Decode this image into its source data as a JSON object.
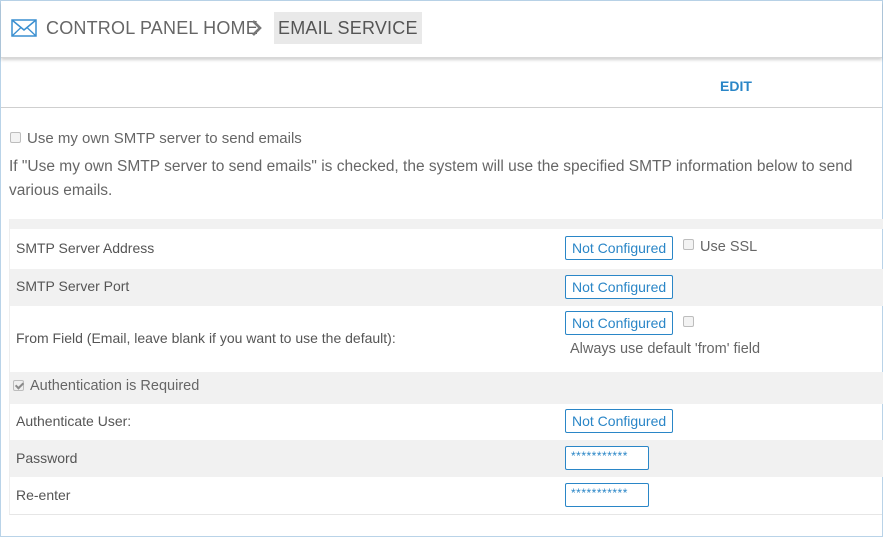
{
  "breadcrumb": {
    "icon": "envelope-icon",
    "home": "CONTROL PANEL HOME",
    "separator_icon": "chevron-right-icon",
    "current": "EMAIL SERVICE"
  },
  "toolbar": {
    "edit": "EDIT"
  },
  "own_smtp": {
    "label": "Use my own SMTP server to send emails",
    "checked": false,
    "description": "If \"Use my own SMTP server to send emails\" is checked, the system will use the specified SMTP information below to send various emails."
  },
  "settings": {
    "server_address": {
      "label": "SMTP Server Address",
      "value": "Not Configured",
      "ssl_label": "Use SSL",
      "ssl_checked": false
    },
    "server_port": {
      "label": "SMTP Server Port",
      "value": "Not Configured"
    },
    "from_field": {
      "label": "From Field (Email, leave blank if you want to use the default):",
      "value": "Not Configured",
      "default_from_label": "Always use default 'from' field",
      "default_from_checked": false
    },
    "auth_required": {
      "label": "Authentication is Required",
      "checked": true
    },
    "auth_user": {
      "label": "Authenticate User:",
      "value": "Not Configured"
    },
    "password": {
      "label": "Password",
      "value": "***********"
    },
    "reenter": {
      "label": "Re-enter",
      "value": "***********"
    }
  },
  "colors": {
    "accent": "#2a86c7",
    "band": "#f1f1f1",
    "frame": "#b9d3e8"
  }
}
